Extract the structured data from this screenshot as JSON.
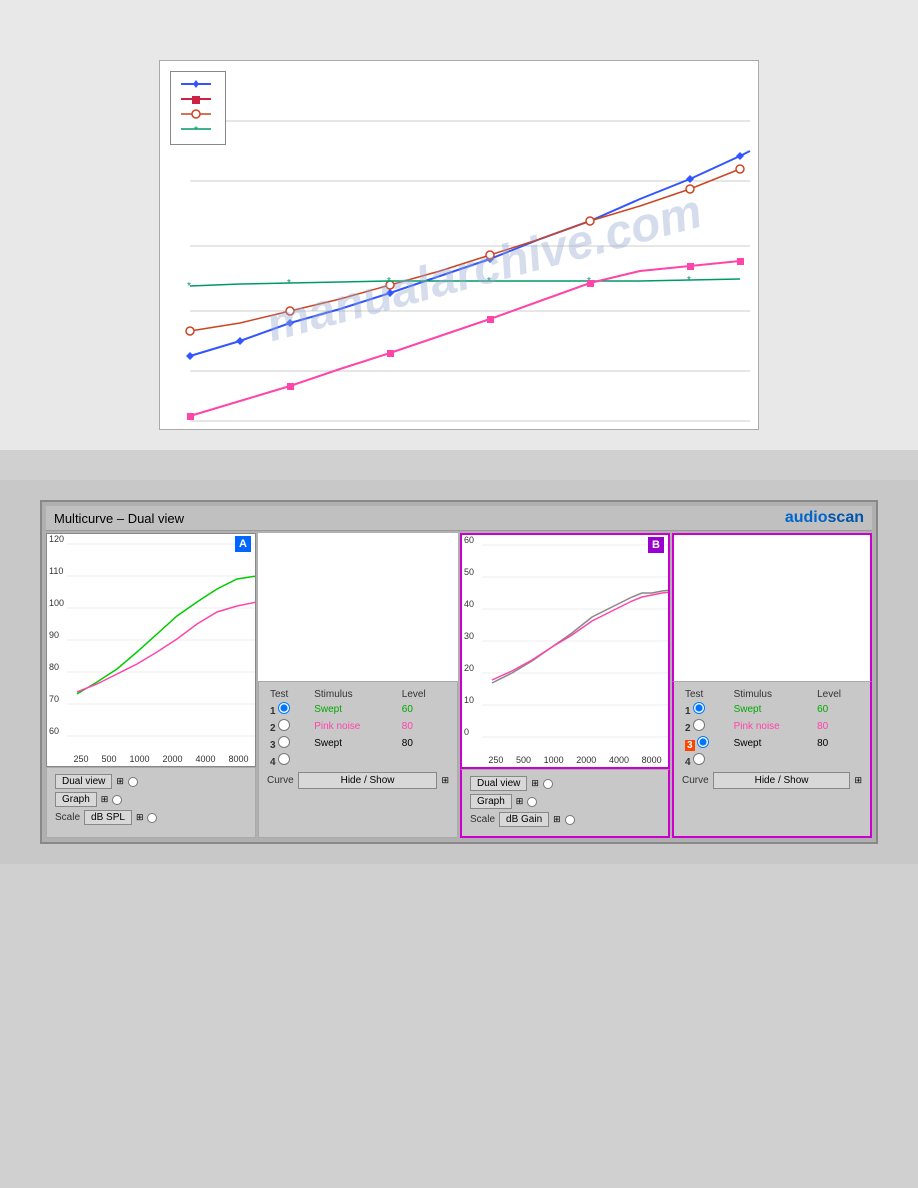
{
  "topChart": {
    "legend": [
      {
        "color": "#3355ff",
        "shape": "diamond",
        "label": ""
      },
      {
        "color": "#cc2244",
        "shape": "square",
        "label": ""
      },
      {
        "color": "#cc4422",
        "shape": "circle",
        "label": ""
      },
      {
        "color": "#009966",
        "shape": "star",
        "label": ""
      }
    ]
  },
  "dualView": {
    "title": "Multicurve – Dual view",
    "brand": "audio",
    "brandAccent": "scan",
    "panelA": {
      "label": "A",
      "yAxisValues": [
        "120",
        "110",
        "100",
        "90",
        "80",
        "70",
        "60"
      ],
      "xAxisValues": [
        "250",
        "500",
        "1000",
        "2000",
        "4000",
        "8000"
      ],
      "scale": "dB SPL",
      "view": "Dual view",
      "graph": "Graph",
      "tests": [
        {
          "num": "1",
          "stimulus": "Swept",
          "level": "60",
          "stimulusClass": "swept"
        },
        {
          "num": "2",
          "stimulus": "Pink noise",
          "level": "80",
          "stimulusClass": "pink"
        },
        {
          "num": "3",
          "stimulus": "Swept",
          "level": "80",
          "stimulusClass": "normal"
        },
        {
          "num": "4",
          "stimulus": "",
          "level": "",
          "stimulusClass": "normal"
        }
      ],
      "curveLabel": "Curve",
      "hideShow": "Hide / Show"
    },
    "panelB": {
      "label": "B",
      "yAxisValues": [
        "60",
        "50",
        "40",
        "30",
        "20",
        "10",
        "0"
      ],
      "xAxisValues": [
        "250",
        "500",
        "1000",
        "2000",
        "4000",
        "8000"
      ],
      "scale": "dB Gain",
      "view": "Dual view",
      "graph": "Graph",
      "tests": [
        {
          "num": "1",
          "stimulus": "Swept",
          "level": "60",
          "stimulusClass": "swept"
        },
        {
          "num": "2",
          "stimulus": "Pink noise",
          "level": "80",
          "stimulusClass": "pink"
        },
        {
          "num": "3",
          "stimulus": "Swept",
          "level": "80",
          "stimulusClass": "normal"
        },
        {
          "num": "4",
          "stimulus": "",
          "level": "",
          "stimulusClass": "normal"
        }
      ],
      "curveLabel": "Curve",
      "hideShow": "Hide / Show"
    }
  },
  "watermark": "manualarchive.com"
}
